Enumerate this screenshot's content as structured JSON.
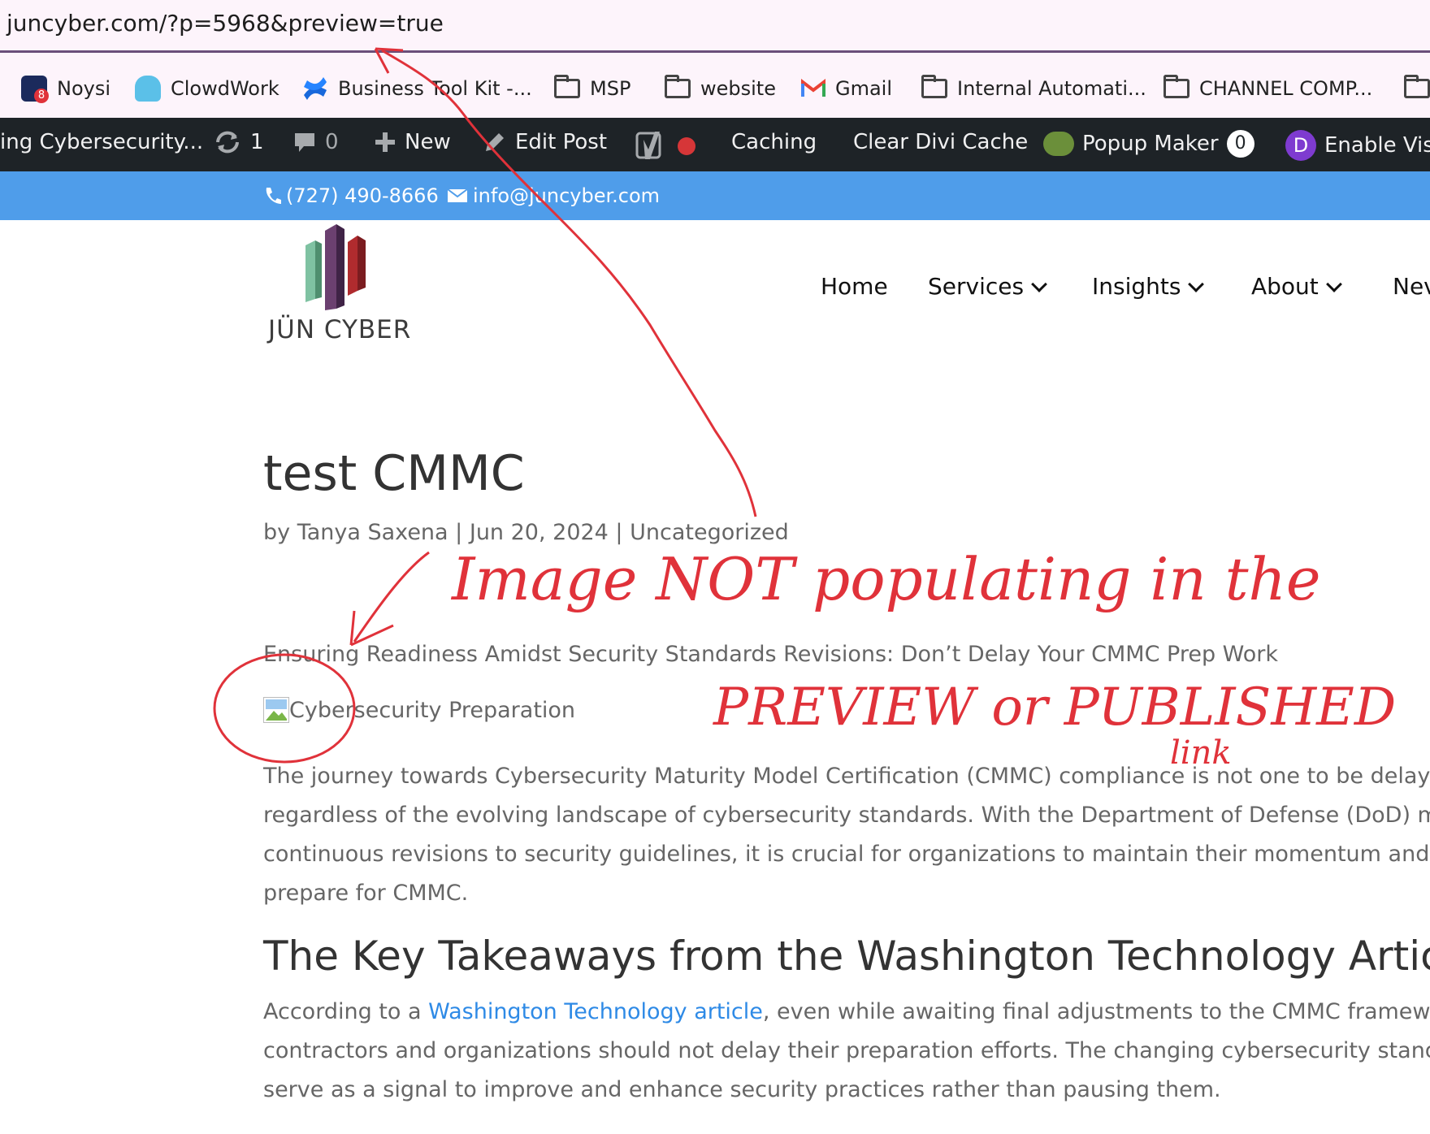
{
  "browser": {
    "url": "juncyber.com/?p=5968&preview=true"
  },
  "bookmarks": [
    {
      "label": "Noysi",
      "icon": "noysi-icon"
    },
    {
      "label": "ClowdWork",
      "icon": "clowdwork-icon"
    },
    {
      "label": "Business Tool Kit -...",
      "icon": "confluence-icon"
    },
    {
      "label": "MSP",
      "icon": "folder-icon"
    },
    {
      "label": "website",
      "icon": "folder-icon"
    },
    {
      "label": "Gmail",
      "icon": "gmail-icon"
    },
    {
      "label": "Internal Automati...",
      "icon": "folder-icon"
    },
    {
      "label": "CHANNEL COMP...",
      "icon": "folder-icon"
    }
  ],
  "admin_bar": {
    "site_name": "ing Cybersecurity...",
    "updates_count": "1",
    "comments_count": "0",
    "new_label": "New",
    "edit_post_label": "Edit Post",
    "caching_label": "Caching",
    "clear_cache_label": "Clear Divi Cache",
    "popup_maker_label": "Popup Maker",
    "popup_maker_count": "0",
    "enable_visual_label": "Enable Vis",
    "status_color": "#d63638"
  },
  "contact": {
    "phone": "(727) 490-8666",
    "email": "info@juncyber.com"
  },
  "header": {
    "logo_text": "JÜN CYBER",
    "nav": [
      "Home",
      "Services",
      "Insights",
      "About",
      "Nev"
    ]
  },
  "article": {
    "title": "test CMMC",
    "meta": "by Tanya Saxena | Jun 20, 2024 | Uncategorized",
    "subtitle": "Ensuring Readiness Amidst Security Standards Revisions: Don’t Delay Your CMMC Prep Work",
    "image_alt": "Cybersecurity Preparation",
    "paragraph1": [
      "The journey towards Cybersecurity Maturity Model Certification (CMMC) compliance is not one to be delayed",
      "regardless of the evolving landscape of cybersecurity standards. With the Department of Defense (DoD) mak",
      "continuous revisions to security guidelines, it is crucial for organizations to maintain their momentum and co",
      "prepare for CMMC."
    ],
    "heading2": "The Key Takeaways from the Washington Technology Artic",
    "paragraph2_prefix": "According to a ",
    "paragraph2_link": "Washington Technology article",
    "paragraph2_suffix": ", even while awaiting final adjustments to the CMMC framewor",
    "paragraph2_rest": [
      "contractors and organizations should not delay their preparation efforts. The changing cybersecurity standar",
      "serve as a signal to improve and enhance security practices rather than pausing them."
    ]
  },
  "annotation": {
    "line1": "Image NOT populating in the",
    "line2": "PREVIEW or PUBLISHED",
    "line3": "link",
    "color": "#e0323a"
  }
}
